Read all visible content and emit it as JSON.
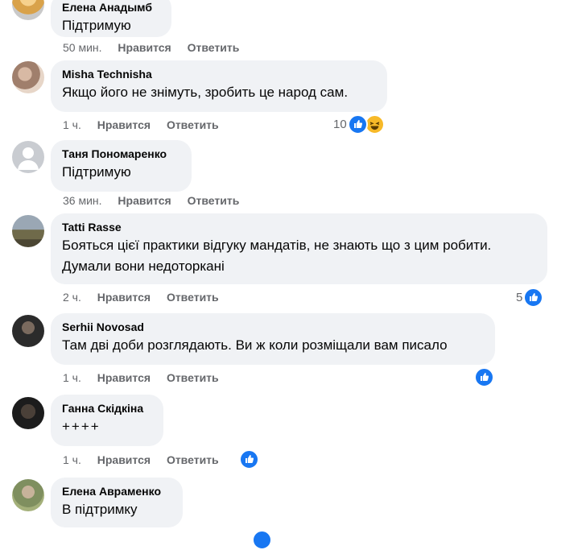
{
  "actions": {
    "like": "Нравится",
    "reply": "Ответить"
  },
  "comments": [
    {
      "author": "Елена Анадымб",
      "text": "Підтримую",
      "time": "50 мин.",
      "reaction_count": ""
    },
    {
      "author": "Misha Technisha",
      "text": "Якщо його не знімуть, зробить це народ сам.",
      "time": "1 ч.",
      "reaction_count": "10",
      "reactions": [
        "like-icon",
        "haha-icon"
      ]
    },
    {
      "author": "Таня Пономаренко",
      "text": "Підтримую",
      "time": "36 мин.",
      "reaction_count": ""
    },
    {
      "author": "Tatti Rasse",
      "text_line1": "Бояться цієї практики відгуку мандатів, не знають що з цим робити.",
      "text_line2": "Думали вони недоторкані",
      "time": "2 ч.",
      "reaction_count": "5",
      "reactions": [
        "like-icon"
      ]
    },
    {
      "author": "Serhii Novosad",
      "text": "Там дві доби розглядають. Ви ж коли розміщали вам писало",
      "time": "1 ч.",
      "reaction_count": "",
      "reactions": [
        "like-icon"
      ]
    },
    {
      "author": "Ганна Скідкіна",
      "text": "++++",
      "time": "1 ч.",
      "reaction_count": "",
      "reactions": [
        "like-icon"
      ]
    },
    {
      "author": "Елена Авраменко",
      "text": "В підтримку",
      "time": "",
      "reaction_count": ""
    }
  ],
  "colors": {
    "bubble": "#f0f2f5",
    "muted": "#65676b",
    "like": "#1877f2",
    "haha": "#f7b928"
  }
}
